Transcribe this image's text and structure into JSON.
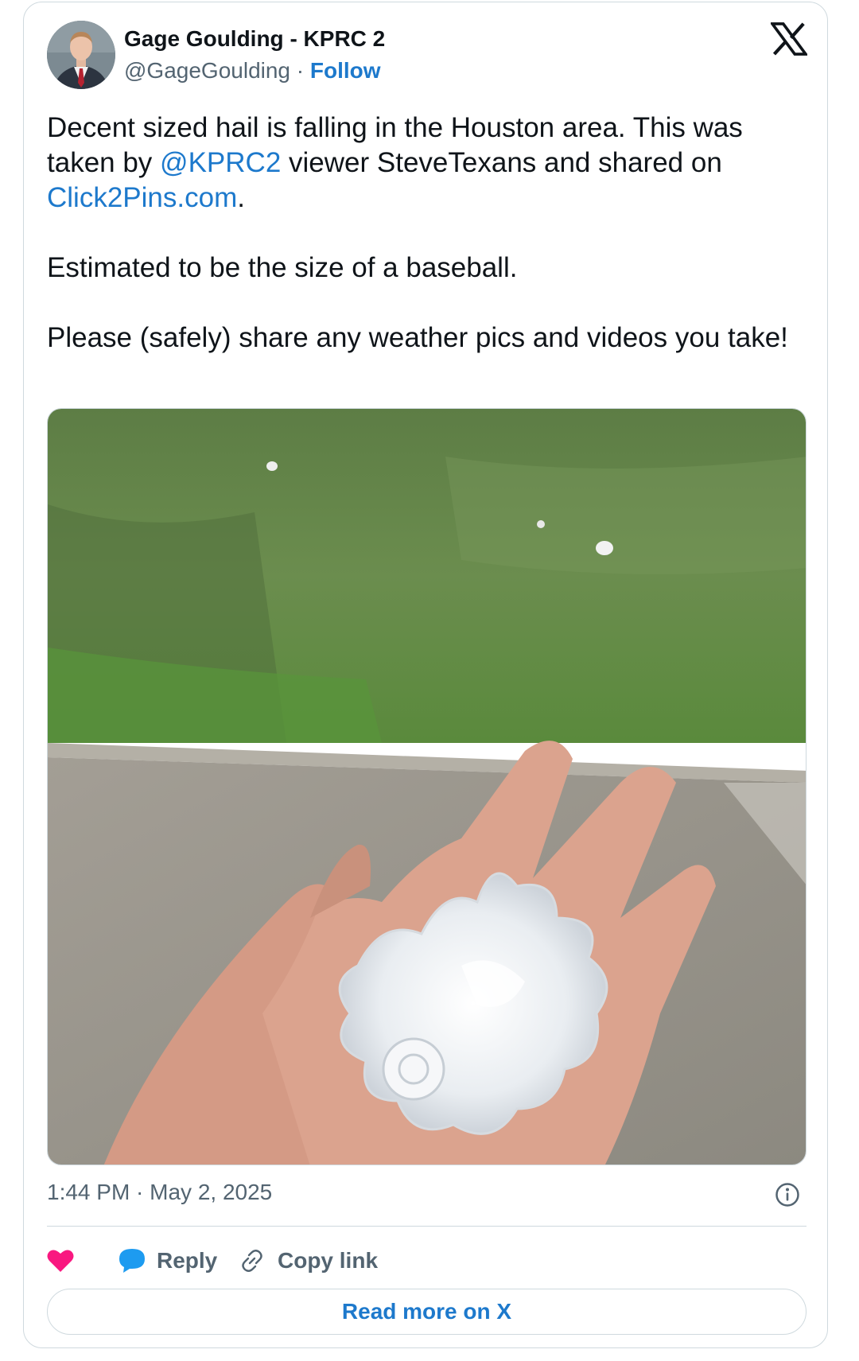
{
  "author": {
    "display_name": "Gage Goulding - KPRC 2",
    "handle": "@GageGoulding",
    "separator": "·",
    "follow_label": "Follow"
  },
  "tweet": {
    "line1_pre": "Decent sized hail is falling in the Houston area. This was taken by ",
    "mention": "@KPRC2",
    "line1_post": " viewer SteveTexans and shared on ",
    "link": "Click2Pins.com",
    "line1_end": ".",
    "paragraph2": "Estimated to be the size of a baseball.",
    "paragraph3": "Please (safely) share any weather pics and videos you take!"
  },
  "timestamp": "1:44 PM · May 2, 2025",
  "actions": {
    "reply_label": "Reply",
    "copy_label": "Copy link"
  },
  "read_more_label": "Read more on X",
  "colors": {
    "link": "#1d79cc",
    "like": "#f91880",
    "reply": "#1d9bf0",
    "secondary_text": "#536471",
    "border": "#cfd9de"
  },
  "icons": {
    "brand": "x-logo-icon",
    "info": "info-icon",
    "like": "heart-icon",
    "reply": "speech-bubble-icon",
    "copy": "link-icon"
  }
}
